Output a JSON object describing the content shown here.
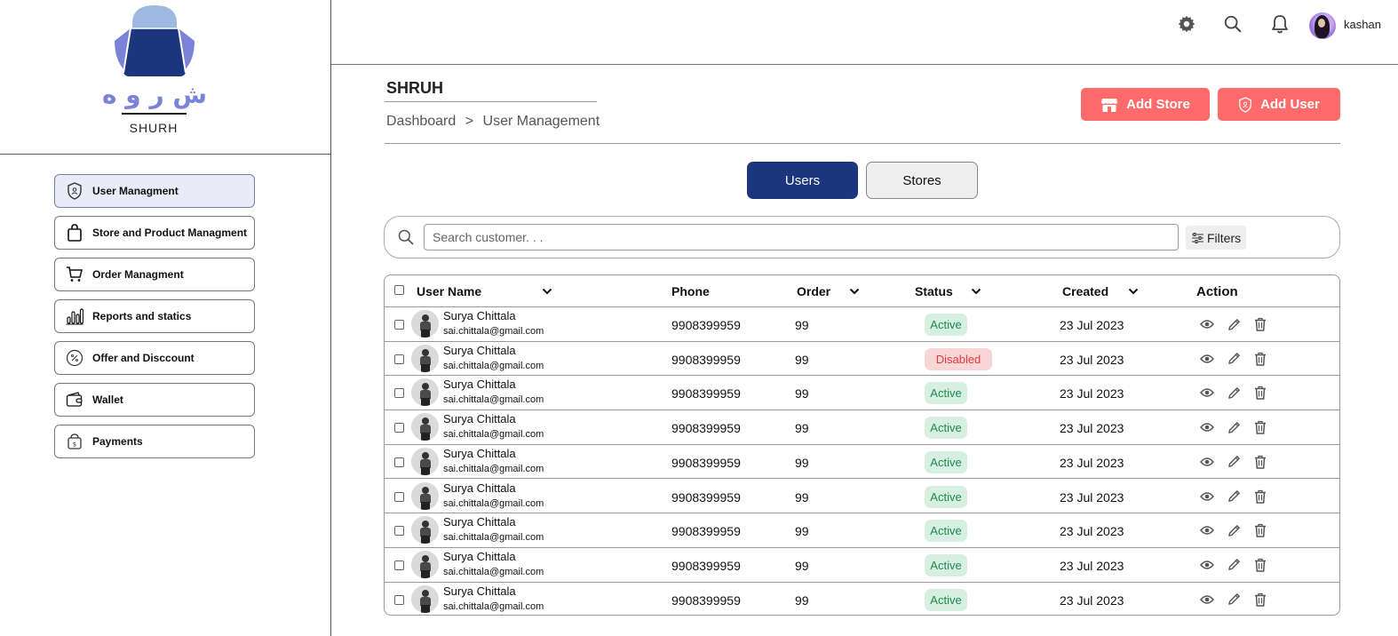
{
  "brand": {
    "arabic": "ش ر و ه",
    "name": "SHURH"
  },
  "sidebar": {
    "items": [
      {
        "label": "User Managment",
        "icon": "shield-user-icon",
        "active": true
      },
      {
        "label": "Store and Product Managment",
        "icon": "shopping-bag-icon",
        "active": false
      },
      {
        "label": "Order Managment",
        "icon": "cart-icon",
        "active": false
      },
      {
        "label": "Reports and statics",
        "icon": "bar-chart-icon",
        "active": false
      },
      {
        "label": "Offer and Disccount",
        "icon": "percent-icon",
        "active": false
      },
      {
        "label": "Wallet",
        "icon": "wallet-icon",
        "active": false
      },
      {
        "label": "Payments",
        "icon": "money-bag-icon",
        "active": false
      }
    ]
  },
  "topbar": {
    "username": "kashan"
  },
  "header": {
    "title": "SHRUH",
    "breadcrumb": [
      "Dashboard",
      ">",
      "User Management"
    ],
    "add_store_label": "Add Store",
    "add_user_label": "Add User"
  },
  "tabs": [
    {
      "label": "Users",
      "active": true
    },
    {
      "label": "Stores",
      "active": false
    }
  ],
  "search": {
    "placeholder": "Search customer. . .",
    "filters_label": "Filters"
  },
  "table": {
    "columns": [
      "User Name",
      "Phone",
      "Order",
      "Status",
      "Created",
      "Action"
    ],
    "rows": [
      {
        "name": "Surya Chittala",
        "email": "sai.chittala@gmail.com",
        "phone": "9908399959",
        "order": "99",
        "status": "Active",
        "created": "23 Jul 2023"
      },
      {
        "name": "Surya Chittala",
        "email": "sai.chittala@gmail.com",
        "phone": "9908399959",
        "order": "99",
        "status": "Disabled",
        "created": "23 Jul 2023"
      },
      {
        "name": "Surya Chittala",
        "email": "sai.chittala@gmail.com",
        "phone": "9908399959",
        "order": "99",
        "status": "Active",
        "created": "23 Jul 2023"
      },
      {
        "name": "Surya Chittala",
        "email": "sai.chittala@gmail.com",
        "phone": "9908399959",
        "order": "99",
        "status": "Active",
        "created": "23 Jul 2023"
      },
      {
        "name": "Surya Chittala",
        "email": "sai.chittala@gmail.com",
        "phone": "9908399959",
        "order": "99",
        "status": "Active",
        "created": "23 Jul 2023"
      },
      {
        "name": "Surya Chittala",
        "email": "sai.chittala@gmail.com",
        "phone": "9908399959",
        "order": "99",
        "status": "Active",
        "created": "23 Jul 2023"
      },
      {
        "name": "Surya Chittala",
        "email": "sai.chittala@gmail.com",
        "phone": "9908399959",
        "order": "99",
        "status": "Active",
        "created": "23 Jul 2023"
      },
      {
        "name": "Surya Chittala",
        "email": "sai.chittala@gmail.com",
        "phone": "9908399959",
        "order": "99",
        "status": "Active",
        "created": "23 Jul 2023"
      },
      {
        "name": "Surya Chittala",
        "email": "sai.chittala@gmail.com",
        "phone": "9908399959",
        "order": "99",
        "status": "Active",
        "created": "23 Jul 2023"
      }
    ]
  },
  "colors": {
    "primary": "#1b357f",
    "accent_red": "#ff6b6b",
    "active_bg": "#d7efe0",
    "active_text": "#1d8a4e",
    "disabled_bg": "#f8d6d6",
    "disabled_text": "#e03a3a",
    "logo_purple": "#7b83d9"
  }
}
